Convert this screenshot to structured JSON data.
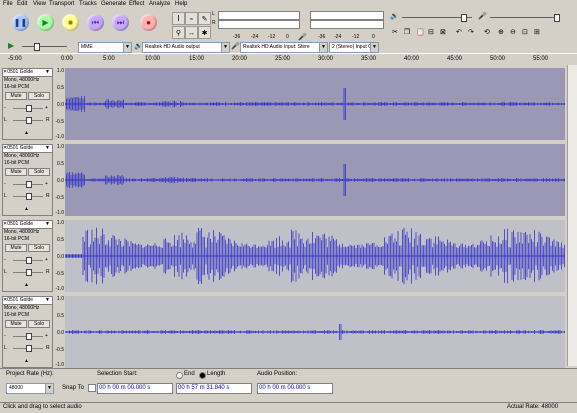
{
  "menu": [
    "File",
    "Edit",
    "View",
    "Transport",
    "Tracks",
    "Generate",
    "Effect",
    "Analyze",
    "Help"
  ],
  "toolbar": {
    "meter_ticks_top": [
      "-36",
      "-24",
      "-12",
      "0"
    ],
    "meter_ticks_bottom": [
      "-36",
      "-24",
      "-12",
      "0"
    ],
    "host": "MME",
    "output_device": "Realtek HD Audio output",
    "input_device": "Realtek HD Audio Input: Stere",
    "channels": "2 (Stereo) Input C"
  },
  "ruler": [
    "-5:00",
    "0:00",
    "5:00",
    "10:00",
    "15:00",
    "20:00",
    "25:00",
    "30:00",
    "35:00",
    "40:00",
    "45:00",
    "50:00",
    "55:00"
  ],
  "tracks": [
    {
      "name": "0501 Golde",
      "rate": "Mono, 48000Hz",
      "format": "16-bit PCM",
      "mute": "Mute",
      "solo": "Solo",
      "gain_l": "L",
      "gain_r": "R",
      "y_ticks": [
        "1.0",
        "0.5",
        "0.0",
        "-0.5",
        "-1.0"
      ]
    },
    {
      "name": "0501 Golde",
      "rate": "Mono, 48000Hz",
      "format": "16-bit PCM",
      "mute": "Mute",
      "solo": "Solo",
      "gain_l": "L",
      "gain_r": "R",
      "y_ticks": [
        "1.0",
        "0.5",
        "0.0",
        "-0.5",
        "-1.0"
      ]
    },
    {
      "name": "0501 Golde",
      "rate": "Mono, 48000Hz",
      "format": "16-bit PCM",
      "mute": "Mute",
      "solo": "Solo",
      "gain_l": "L",
      "gain_r": "R",
      "y_ticks": [
        "1.0",
        "0.5",
        "0.0",
        "-0.5",
        "-1.0"
      ]
    },
    {
      "name": "0501 Golde",
      "rate": "Mono, 48000Hz",
      "format": "16-bit PCM",
      "mute": "Mute",
      "solo": "Solo",
      "gain_l": "L",
      "gain_r": "R",
      "y_ticks": [
        "1.0",
        "0.5",
        "0.0",
        "-0.5",
        "-1.0"
      ]
    }
  ],
  "bottom": {
    "project_rate_label": "Project Rate (Hz):",
    "project_rate": "48000",
    "snap_to": "Snap To",
    "selection_start_label": "Selection Start:",
    "end_label": "End",
    "length_label": "Length",
    "audio_position_label": "Audio Position:",
    "selection_start": "00 h 00 m 00.000 s",
    "length": "00 h 57 m 31.840 s",
    "audio_position": "00 h 00 m 00.000 s"
  },
  "status": {
    "left": "Click and drag to select audio",
    "right": "Actual Rate: 48000"
  },
  "colors": {
    "wave": "#3232c8",
    "track_bg_selected": "#9a98b4",
    "track_bg": "#c0c0c8"
  },
  "icons": [
    "pause-icon",
    "play-icon",
    "stop-icon",
    "skip-start-icon",
    "skip-end-icon",
    "record-icon",
    "speaker-icon",
    "mic-icon"
  ]
}
